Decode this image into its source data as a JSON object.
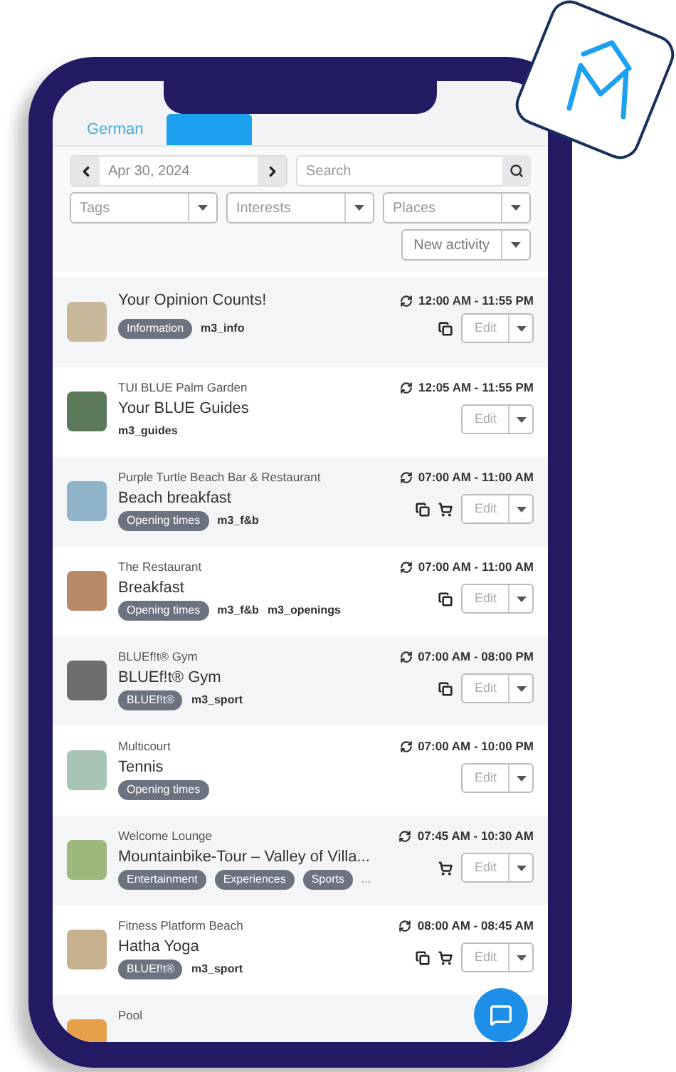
{
  "tabs": [
    {
      "label": "German",
      "selected": false
    },
    {
      "selected": true
    }
  ],
  "toolbar": {
    "date": "Apr 30, 2024",
    "search_placeholder": "Search",
    "filters": [
      {
        "placeholder": "Tags"
      },
      {
        "placeholder": "Interests"
      },
      {
        "placeholder": "Places"
      }
    ],
    "new_button": "New activity"
  },
  "activities": [
    {
      "title": "Your Opinion Counts!",
      "time": "12:00 AM - 11:55 PM",
      "tags": [
        {
          "kind": "pill",
          "label": "Information"
        },
        {
          "kind": "code",
          "label": "m3_info"
        }
      ],
      "copy": true,
      "cart": false,
      "edit": "Edit"
    },
    {
      "venue": "TUI BLUE Palm Garden",
      "title": "Your BLUE Guides",
      "time": "12:05 AM - 11:55 PM",
      "tags": [
        {
          "kind": "code",
          "label": "m3_guides"
        }
      ],
      "copy": false,
      "cart": false,
      "edit": "Edit"
    },
    {
      "venue": "Purple Turtle Beach Bar & Restaurant",
      "title": "Beach breakfast",
      "time": "07:00 AM - 11:00 AM",
      "tags": [
        {
          "kind": "pill",
          "label": "Opening times"
        },
        {
          "kind": "code",
          "label": "m3_f&b"
        }
      ],
      "copy": true,
      "cart": true,
      "edit": "Edit"
    },
    {
      "venue": "The Restaurant",
      "title": "Breakfast",
      "time": "07:00 AM - 11:00 AM",
      "tags": [
        {
          "kind": "pill",
          "label": "Opening times"
        },
        {
          "kind": "code",
          "label": "m3_f&b"
        },
        {
          "kind": "code",
          "label": "m3_openings"
        }
      ],
      "copy": true,
      "cart": false,
      "edit": "Edit"
    },
    {
      "venue": "BLUEf!t® Gym",
      "title": "BLUEf!t® Gym",
      "time": "07:00 AM - 08:00 PM",
      "tags": [
        {
          "kind": "pill",
          "label": "BLUEf!t®"
        },
        {
          "kind": "code",
          "label": "m3_sport"
        }
      ],
      "copy": true,
      "cart": false,
      "edit": "Edit"
    },
    {
      "venue": "Multicourt",
      "title": "Tennis",
      "time": "07:00 AM - 10:00 PM",
      "tags": [
        {
          "kind": "pill",
          "label": "Opening times"
        }
      ],
      "copy": false,
      "cart": false,
      "edit": "Edit"
    },
    {
      "venue": "Welcome Lounge",
      "title": "Mountainbike-Tour – Valley of Villa...",
      "time": "07:45 AM - 10:30 AM",
      "tags": [
        {
          "kind": "pill",
          "label": "Entertainment"
        },
        {
          "kind": "pill",
          "label": "Experiences"
        },
        {
          "kind": "pill",
          "label": "Sports"
        },
        {
          "kind": "more",
          "label": "..."
        }
      ],
      "copy": false,
      "cart": true,
      "edit": "Edit"
    },
    {
      "venue": "Fitness Platform Beach",
      "title": "Hatha Yoga",
      "time": "08:00 AM - 08:45 AM",
      "tags": [
        {
          "kind": "pill",
          "label": "BLUEf!t®"
        },
        {
          "kind": "code",
          "label": "m3_sport"
        }
      ],
      "copy": true,
      "cart": true,
      "edit": "Edit"
    },
    {
      "venue": "Pool",
      "copy": false,
      "cart": false
    }
  ]
}
